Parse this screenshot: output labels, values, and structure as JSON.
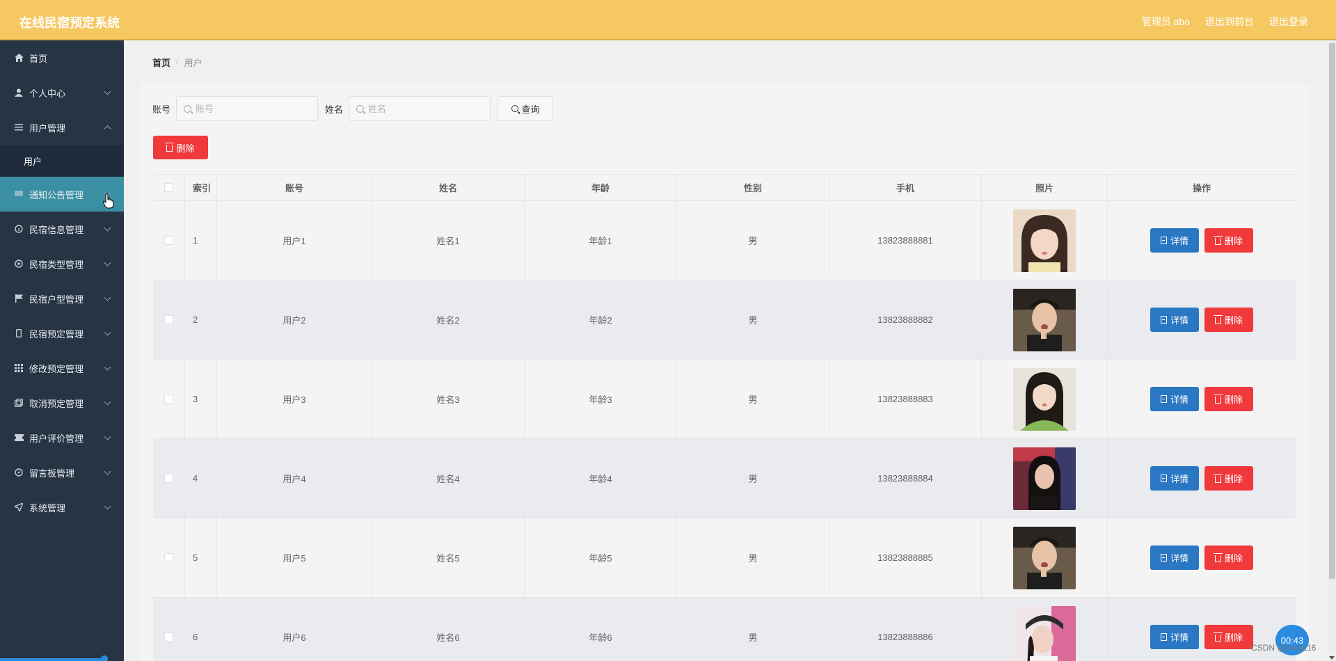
{
  "header": {
    "title": "在线民宿预定系统",
    "user_label": "管理员 abo",
    "front_link": "退出到前台",
    "logout_link": "退出登录"
  },
  "sidebar": {
    "items": [
      {
        "label": "首页",
        "icon": "home-icon",
        "expand": "none"
      },
      {
        "label": "个人中心",
        "icon": "user-icon",
        "expand": "down"
      },
      {
        "label": "用户管理",
        "icon": "list-icon",
        "expand": "up"
      },
      {
        "label": "用户",
        "icon": "",
        "expand": "sub"
      },
      {
        "label": "通知公告管理",
        "icon": "message-icon",
        "expand": "down",
        "active": true
      },
      {
        "label": "民宿信息管理",
        "icon": "info-icon",
        "expand": "down"
      },
      {
        "label": "民宿类型管理",
        "icon": "settings-icon",
        "expand": "down"
      },
      {
        "label": "民宿户型管理",
        "icon": "flag-icon",
        "expand": "down"
      },
      {
        "label": "民宿预定管理",
        "icon": "phone-icon",
        "expand": "down"
      },
      {
        "label": "修改预定管理",
        "icon": "grid-icon",
        "expand": "down"
      },
      {
        "label": "取消预定管理",
        "icon": "copy-icon",
        "expand": "down"
      },
      {
        "label": "用户评价管理",
        "icon": "ticket-icon",
        "expand": "down"
      },
      {
        "label": "留言板管理",
        "icon": "compass-icon",
        "expand": "down"
      },
      {
        "label": "系统管理",
        "icon": "send-icon",
        "expand": "down"
      }
    ]
  },
  "breadcrumb": {
    "home": "首页",
    "separator": "/",
    "current": "用户"
  },
  "search": {
    "account_label": "账号",
    "account_placeholder": "账号",
    "account_value": "",
    "name_label": "姓名",
    "name_placeholder": "姓名",
    "name_value": "",
    "query_label": "查询"
  },
  "bulk_delete_label": "删除",
  "table": {
    "columns": [
      "索引",
      "账号",
      "姓名",
      "年龄",
      "性别",
      "手机",
      "照片",
      "操作"
    ],
    "detail_label": "详情",
    "delete_label": "删除",
    "rows": [
      {
        "index": "1",
        "account": "用户1",
        "name": "姓名1",
        "age": "年龄1",
        "sex": "男",
        "phone": "13823888881"
      },
      {
        "index": "2",
        "account": "用户2",
        "name": "姓名2",
        "age": "年龄2",
        "sex": "男",
        "phone": "13823888882"
      },
      {
        "index": "3",
        "account": "用户3",
        "name": "姓名3",
        "age": "年龄3",
        "sex": "男",
        "phone": "13823888883"
      },
      {
        "index": "4",
        "account": "用户4",
        "name": "姓名4",
        "age": "年龄4",
        "sex": "男",
        "phone": "13823888884"
      },
      {
        "index": "5",
        "account": "用户5",
        "name": "姓名5",
        "age": "年龄5",
        "sex": "男",
        "phone": "13823888885"
      },
      {
        "index": "6",
        "account": "用户6",
        "name": "姓名6",
        "age": "年龄6",
        "sex": "男",
        "phone": "13823888886"
      }
    ]
  },
  "overlay": {
    "timer": "00:43",
    "watermark": "CSDN @sheji116"
  },
  "colors": {
    "header": "#f5c862",
    "sidebar": "#273444",
    "active_menu": "#3b8fa3",
    "primary": "#2a77c3",
    "danger": "#f0393b"
  }
}
